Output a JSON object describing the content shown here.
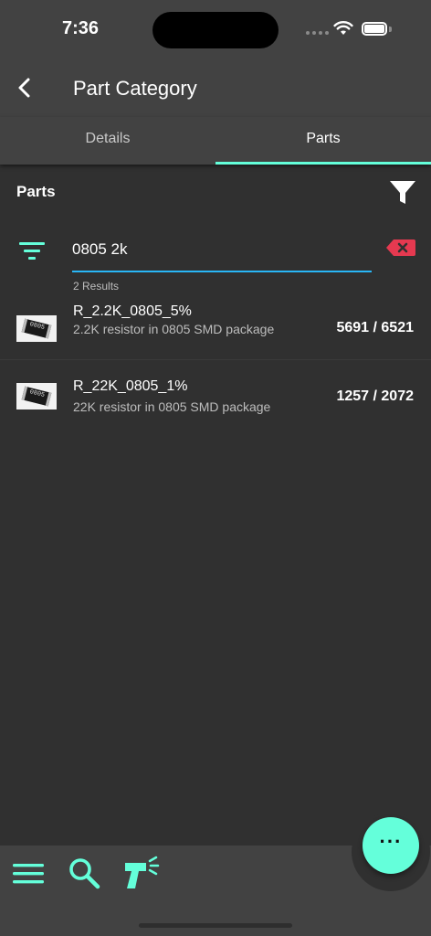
{
  "status_bar": {
    "time": "7:36"
  },
  "app_bar": {
    "title": "Part Category"
  },
  "tabs": [
    {
      "label": "Details",
      "active": false
    },
    {
      "label": "Parts",
      "active": true
    }
  ],
  "section": {
    "title": "Parts"
  },
  "search": {
    "value": "0805 2k",
    "placeholder": ""
  },
  "results": {
    "count_label": "2 Results"
  },
  "parts": [
    {
      "name": "R_2.2K_0805_5%",
      "description": "2.2K resistor in 0805 SMD package",
      "stock": "5691 / 6521",
      "thumb_label": "0805"
    },
    {
      "name": "R_22K_0805_1%",
      "description": "22K resistor in 0805 SMD package",
      "stock": "1257 / 2072",
      "thumb_label": "0805"
    }
  ],
  "bottom_nav": {
    "items": [
      "menu-icon",
      "search-icon",
      "barcode-scanner-icon"
    ],
    "fab_icon": "more-horizontal-icon"
  },
  "colors": {
    "accent": "#64ffda",
    "input_underline": "#29b6f6",
    "clear": "#e53950",
    "background": "#303030",
    "bar": "#424242"
  }
}
